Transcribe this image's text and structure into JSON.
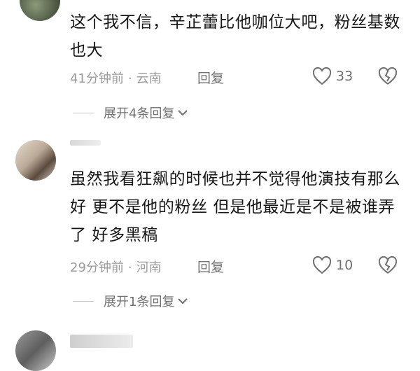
{
  "comments": [
    {
      "text": "这个我不信，辛芷蕾比他咖位大吧，粉丝基数也大",
      "time": "41分钟前",
      "location": "云南",
      "reply_label": "回复",
      "likes": "33",
      "expand_label": "展开4条回复"
    },
    {
      "text": "虽然我看狂飙的时候也并不觉得他演技有那么好 更不是他的粉丝 但是他最近是不是被谁弄了 好多黑稿",
      "time": "29分钟前",
      "location": "河南",
      "reply_label": "回复",
      "likes": "10",
      "expand_label": "展开1条回复"
    }
  ],
  "icons": {
    "like": "heart-outline-icon",
    "dislike": "broken-heart-icon",
    "expand": "chevron-down-icon"
  },
  "colors": {
    "text": "#161616",
    "meta": "#9a9a9a",
    "action": "#707070",
    "divider": "#c8c8c8"
  }
}
